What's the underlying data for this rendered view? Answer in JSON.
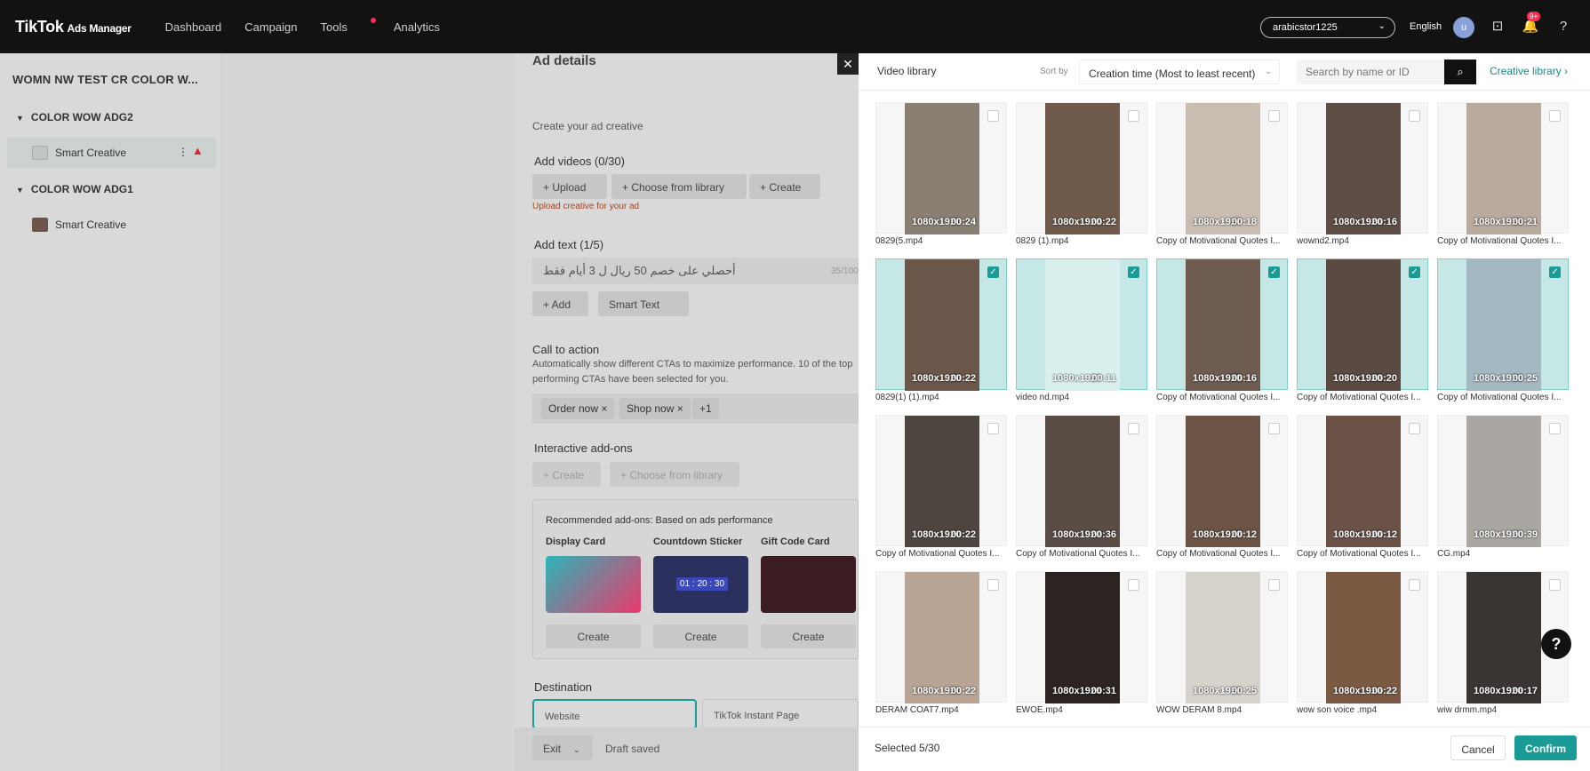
{
  "app": {
    "brand": "TikTok",
    "subbrand": "Ads Manager"
  },
  "nav": [
    "Dashboard",
    "Campaign",
    "Tools",
    "Analytics"
  ],
  "header": {
    "account": "arabicstor1225",
    "language": "English",
    "avatar": "u",
    "notif_badge": "9+"
  },
  "sidebar": {
    "campaign": "WOMN NW TEST CR COLOR W...",
    "groups": [
      {
        "name": "COLOR WOW ADG2",
        "item": "Smart Creative"
      },
      {
        "name": "COLOR WOW ADG1",
        "item": "Smart Creative"
      }
    ]
  },
  "ad": {
    "title": "Ad details",
    "create_label": "Create your ad creative",
    "add_videos": "Add videos (0/30)",
    "upload": "+ Upload",
    "choose": "+ Choose from library",
    "create": "+ Create",
    "upload_hint": "Upload creative for your ad",
    "add_text": "Add text (1/5)",
    "text_value": "أحصلي على خصم 50 ريال ل 3 أيام فقط",
    "text_count": "35/100",
    "add": "+ Add",
    "smart_text": "Smart Text",
    "cta_title": "Call to action",
    "cta_desc1": "Automatically show different CTAs to maximize performance. 10 of the top",
    "cta_desc2": "performing CTAs have been selected for you.",
    "cta_tags": [
      "Order now ×",
      "Shop now ×",
      "+1"
    ],
    "addons_title": "Interactive add-ons",
    "addons_create": "+ Create",
    "addons_choose": "+ Choose from library",
    "rec_title": "Recommended add-ons: Based on ads performance",
    "cards": [
      "Display Card",
      "Countdown Sticker",
      "Gift Code Card"
    ],
    "card_create": "Create",
    "countdown": "01 : 20 : 30",
    "destination": "Destination",
    "dest_options": [
      "Website",
      "TikTok Instant Page"
    ],
    "exit": "Exit",
    "draft": "Draft saved"
  },
  "library": {
    "title": "Video library",
    "sort_label": "Sort by",
    "sort_value": "Creation time (Most to least recent)",
    "search_placeholder": "Search by name or ID",
    "creative_library": "Creative library ›",
    "selected": "Selected 5/30",
    "cancel": "Cancel",
    "confirm": "Confirm",
    "videos": [
      {
        "name": "0829(5.mp4",
        "res": "1080x1920",
        "dur": "00:24",
        "sel": false,
        "color": "#8a7f73"
      },
      {
        "name": "0829 (1).mp4",
        "res": "1080x1920",
        "dur": "00:22",
        "sel": false,
        "color": "#6f5a4c"
      },
      {
        "name": "Copy of Motivational Quotes I...",
        "res": "1080x1920",
        "dur": "00:18",
        "sel": false,
        "color": "#c9bdb2"
      },
      {
        "name": "wownd2.mp4",
        "res": "1080x1920",
        "dur": "00:16",
        "sel": false,
        "color": "#5e4e46"
      },
      {
        "name": "Copy of Motivational Quotes I...",
        "res": "1080x1920",
        "dur": "00:21",
        "sel": false,
        "color": "#b8aa9c"
      },
      {
        "name": "0829(1) (1).mp4",
        "res": "1080x1920",
        "dur": "00:22",
        "sel": true,
        "color": "#6a574a"
      },
      {
        "name": "video nd.mp4",
        "res": "1080x1920",
        "dur": "00:11",
        "sel": true,
        "color": "#d9f0ef"
      },
      {
        "name": "Copy of Motivational Quotes I...",
        "res": "1080x1920",
        "dur": "00:16",
        "sel": true,
        "color": "#6f5c50"
      },
      {
        "name": "Copy of Motivational Quotes I...",
        "res": "1080x1920",
        "dur": "00:20",
        "sel": true,
        "color": "#5b4a42"
      },
      {
        "name": "Copy of Motivational Quotes I...",
        "res": "1080x1920",
        "dur": "00:25",
        "sel": true,
        "color": "#a4b8c2"
      },
      {
        "name": "Copy of Motivational Quotes I...",
        "res": "1080x1920",
        "dur": "00:22",
        "sel": false,
        "color": "#4f4540"
      },
      {
        "name": "Copy of Motivational Quotes I...",
        "res": "1080x1920",
        "dur": "00:36",
        "sel": false,
        "color": "#5a4d45"
      },
      {
        "name": "Copy of Motivational Quotes I...",
        "res": "1080x1920",
        "dur": "00:12",
        "sel": false,
        "color": "#6b5446"
      },
      {
        "name": "Copy of Motivational Quotes I...",
        "res": "1080x1920",
        "dur": "00:12",
        "sel": false,
        "color": "#6a5246"
      },
      {
        "name": "CG.mp4",
        "res": "1080x1920",
        "dur": "00:39",
        "sel": false,
        "color": "#aaa6a2"
      },
      {
        "name": "DERAM COAT7.mp4",
        "res": "1080x1920",
        "dur": "00:22",
        "sel": false,
        "color": "#b9a596"
      },
      {
        "name": "EWOE.mp4",
        "res": "1080x1920",
        "dur": "00:31",
        "sel": false,
        "color": "#2b2421"
      },
      {
        "name": "WOW DERAM 8.mp4",
        "res": "1080x1920",
        "dur": "00:25",
        "sel": false,
        "color": "#d8d2cc"
      },
      {
        "name": "wow son voice .mp4",
        "res": "1080x1920",
        "dur": "00:22",
        "sel": false,
        "color": "#7b5a43"
      },
      {
        "name": "wiw drmm.mp4",
        "res": "1080x1920",
        "dur": "00:17",
        "sel": false,
        "color": "#3a3533"
      }
    ]
  }
}
